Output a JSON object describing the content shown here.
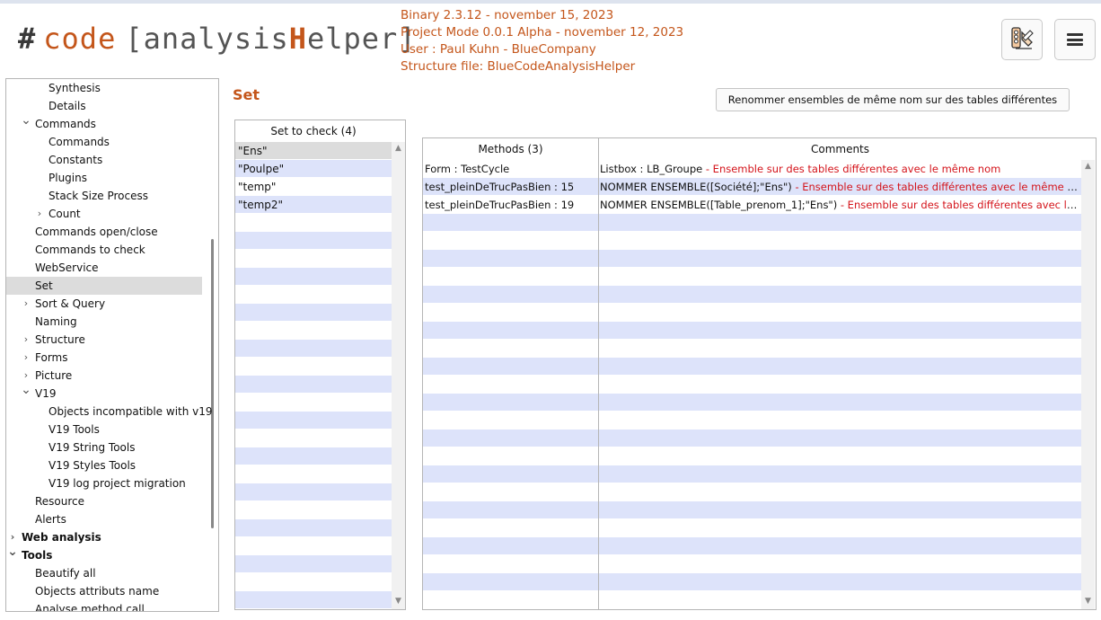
{
  "header": {
    "logo": {
      "hash": "#",
      "code": "code",
      "open": "[",
      "part1": "analysis",
      "h": "H",
      "part2": "elper",
      "close": "]"
    },
    "info": [
      "Binary 2.3.12 - november 15, 2023",
      "Project Mode 0.0.1 Alpha - november 12, 2023",
      "User : Paul Kuhn - BlueCompany",
      "Structure file: BlueCodeAnalysisHelper"
    ],
    "buttons": {
      "tools_icon": "tools-icon",
      "menu_icon": "hamburger-menu-icon"
    }
  },
  "sidebar": {
    "items": [
      {
        "label": "Synthesis",
        "indent": 2,
        "chevron": ""
      },
      {
        "label": "Details",
        "indent": 2,
        "chevron": ""
      },
      {
        "label": "Commands",
        "indent": 1,
        "chevron": "expanded"
      },
      {
        "label": "Commands",
        "indent": 2,
        "chevron": ""
      },
      {
        "label": "Constants",
        "indent": 2,
        "chevron": ""
      },
      {
        "label": "Plugins",
        "indent": 2,
        "chevron": ""
      },
      {
        "label": "Stack Size Process",
        "indent": 2,
        "chevron": ""
      },
      {
        "label": "Count",
        "indent": 2,
        "chevron": "collapsed"
      },
      {
        "label": "Commands open/close",
        "indent": 1,
        "chevron": ""
      },
      {
        "label": "Commands to check",
        "indent": 1,
        "chevron": ""
      },
      {
        "label": "WebService",
        "indent": 1,
        "chevron": ""
      },
      {
        "label": "Set",
        "indent": 1,
        "chevron": "",
        "selected": true
      },
      {
        "label": "Sort & Query",
        "indent": 1,
        "chevron": "collapsed"
      },
      {
        "label": "Naming",
        "indent": 1,
        "chevron": ""
      },
      {
        "label": "Structure",
        "indent": 1,
        "chevron": "collapsed"
      },
      {
        "label": "Forms",
        "indent": 1,
        "chevron": "collapsed"
      },
      {
        "label": "Picture",
        "indent": 1,
        "chevron": "collapsed"
      },
      {
        "label": "V19",
        "indent": 1,
        "chevron": "expanded"
      },
      {
        "label": "Objects incompatible with v19",
        "indent": 2,
        "chevron": ""
      },
      {
        "label": "V19 Tools",
        "indent": 2,
        "chevron": ""
      },
      {
        "label": "V19 String Tools",
        "indent": 2,
        "chevron": ""
      },
      {
        "label": "V19 Styles Tools",
        "indent": 2,
        "chevron": ""
      },
      {
        "label": "V19 log project migration",
        "indent": 2,
        "chevron": ""
      },
      {
        "label": "Resource",
        "indent": 1,
        "chevron": ""
      },
      {
        "label": "Alerts",
        "indent": 1,
        "chevron": ""
      },
      {
        "label": "Web analysis",
        "indent": 0,
        "chevron": "collapsed",
        "bold": true
      },
      {
        "label": "Tools",
        "indent": 0,
        "chevron": "expanded",
        "bold": true
      },
      {
        "label": "Beautify all",
        "indent": 1,
        "chevron": ""
      },
      {
        "label": "Objects attributs name",
        "indent": 1,
        "chevron": ""
      },
      {
        "label": "Analyse method call",
        "indent": 1,
        "chevron": ""
      }
    ]
  },
  "main": {
    "title": "Set",
    "rename_button": "Renommer ensembles de même nom sur des tables différentes",
    "set_list": {
      "header": "Set to check (4)",
      "items": [
        "\"Ens\"",
        "\"Poulpe\"",
        "\"temp\"",
        "\"temp2\""
      ],
      "selected_index": 0
    },
    "methods_table": {
      "headers": [
        "Methods (3)",
        "Comments"
      ],
      "rows": [
        {
          "method": "Form : TestCycle",
          "comment": "Listbox : LB_Groupe",
          "warning": " - Ensemble sur des tables différentes avec le même nom"
        },
        {
          "method": "test_pleinDeTrucPasBien : 15",
          "comment": "NOMMER ENSEMBLE([Société];\"Ens\")",
          "warning": " - Ensemble sur des tables différentes avec le même nom"
        },
        {
          "method": "test_pleinDeTrucPasBien : 19",
          "comment": "NOMMER ENSEMBLE([Table_prenom_1];\"Ens\")",
          "warning": " - Ensemble sur des tables différentes avec le même nom"
        }
      ]
    }
  },
  "colors": {
    "accent": "#c4561b",
    "warning": "#d4141b",
    "row_alt": "#dde3fa",
    "selected": "#dcdcdc"
  }
}
